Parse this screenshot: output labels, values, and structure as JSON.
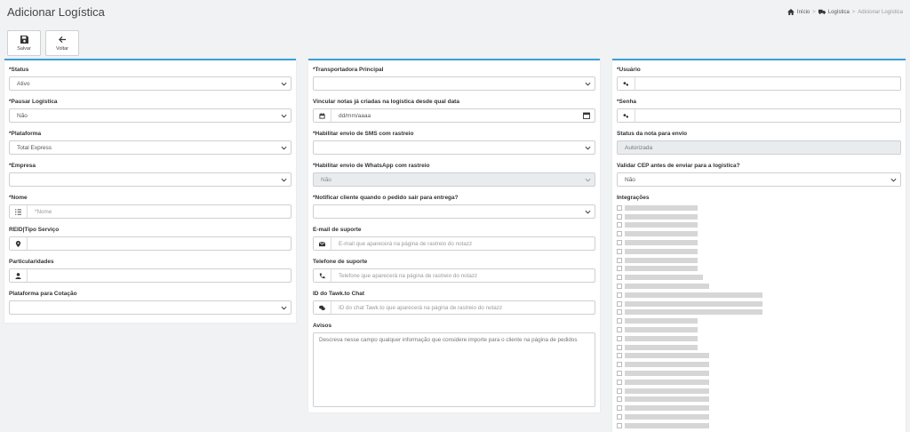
{
  "header": {
    "title": "Adicionar Logística",
    "breadcrumb": {
      "home": "Início",
      "section": "Logística",
      "current": "Adicionar Logística"
    }
  },
  "toolbar": {
    "save_label": "Salvar",
    "back_label": "Voltar"
  },
  "col1": {
    "status": {
      "label": "*Status",
      "value": "Ativo"
    },
    "pausar": {
      "label": "*Pausar Logística",
      "value": "Não"
    },
    "plataforma": {
      "label": "*Plataforma",
      "value": "Total Express"
    },
    "empresa": {
      "label": "*Empresa",
      "value": ""
    },
    "nome": {
      "label": "*Nome",
      "placeholder": "*Nome"
    },
    "reid": {
      "label": "REID|Tipo Serviço",
      "value": ""
    },
    "particularidades": {
      "label": "Particularidades",
      "value": ""
    },
    "cotacao": {
      "label": "Plataforma para Cotação",
      "value": ""
    }
  },
  "col2": {
    "transportadora": {
      "label": "*Transportadora Principal",
      "value": ""
    },
    "vincular": {
      "label": "Vincular notas já criadas na logística desde qual data",
      "value": "dd/mm/aaaa"
    },
    "sms": {
      "label": "*Habilitar envio de SMS com rastreio",
      "value": ""
    },
    "whatsapp": {
      "label": "*Habilitar envio de WhatsApp com rastreio",
      "value": "Não"
    },
    "notificar": {
      "label": "*Notificar cliente quando o pedido sair para entrega?",
      "value": ""
    },
    "email": {
      "label": "E-mail de suporte",
      "placeholder": "E-mail que aparecerá na página de rastreio do notazz"
    },
    "telefone": {
      "label": "Telefone de suporte",
      "placeholder": "Telefone que aparecerá na página de rastreio do notazz"
    },
    "tawk": {
      "label": "ID do Tawk.to Chat",
      "placeholder": "ID do chat Tawk.to que aparecerá na página de rastreio do notazz"
    },
    "avisos": {
      "label": "Avisos",
      "placeholder": "Descreva nesse campo qualquer informação que considere importe para o cliente na página de pedidos"
    }
  },
  "col3": {
    "usuario": {
      "label": "*Usuário",
      "value": ""
    },
    "senha": {
      "label": "*Senha",
      "value": ""
    },
    "status_nota": {
      "label": "Status da nota para envio",
      "value": "Autorizada"
    },
    "validar_cep": {
      "label": "Validar CEP antes de enviar para a logística?",
      "value": "Não"
    },
    "integracoes": {
      "label": "Integrações",
      "item_count": 26
    }
  },
  "colors": {
    "accent": "#3aa0d8",
    "background": "#f1f2f4"
  },
  "icons": [
    "home-icon",
    "truck-icon",
    "save-icon",
    "arrow-left-icon",
    "chevron-down-icon",
    "list-icon",
    "map-marker-icon",
    "user-icon",
    "calendar-icon",
    "envelope-icon",
    "phone-icon",
    "comments-icon",
    "key-icon"
  ]
}
